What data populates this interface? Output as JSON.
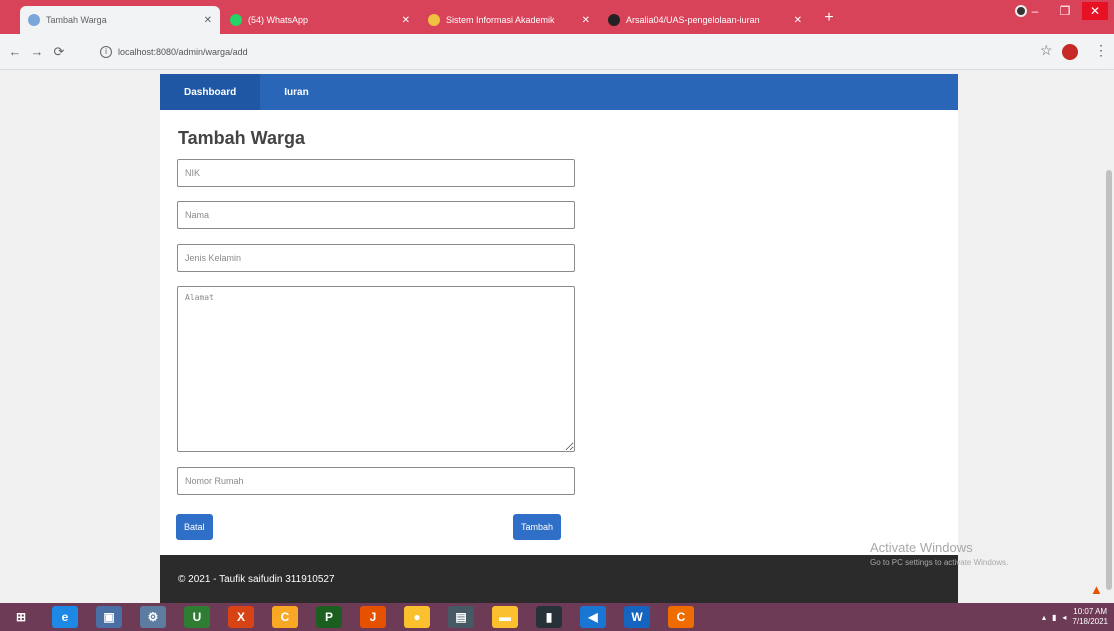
{
  "browser": {
    "tabs": [
      {
        "title": "Tambah Warga",
        "active": true,
        "icon_color": "#7aa7d9"
      },
      {
        "title": "(54) WhatsApp",
        "active": false,
        "icon_color": "#25d366"
      },
      {
        "title": "Sistem Informasi Akademik",
        "active": false,
        "icon_color": "#f0c040"
      },
      {
        "title": "Arsalia04/UAS-pengelolaan-iuran",
        "active": false,
        "icon_color": "#222222"
      }
    ],
    "new_tab": "+",
    "url": "localhost:8080/admin/warga/add",
    "info_icon": "i",
    "controls": {
      "minimize": "–",
      "maximize": "❐",
      "close": "✕"
    }
  },
  "navbar": {
    "links": [
      {
        "label": "Dashboard",
        "active": true
      },
      {
        "label": "Iuran",
        "active": false
      }
    ]
  },
  "form": {
    "title": "Tambah Warga",
    "nik_placeholder": "NIK",
    "nama_placeholder": "Nama",
    "jenis_kelamin_placeholder": "Jenis Kelamin",
    "alamat_placeholder": "Alamat",
    "nomor_rumah_placeholder": "Nomor Rumah",
    "batal_label": "Batal",
    "tambah_label": "Tambah"
  },
  "footer": {
    "text": "© 2021 - Taufik saifudin 311910527"
  },
  "watermark": {
    "title": "Activate Windows",
    "subtitle": "Go to PC settings to activate Windows."
  },
  "taskbar": {
    "clock_time": "10:07 AM",
    "clock_date": "7/18/2021",
    "items": [
      {
        "name": "start",
        "glyph": "⊞",
        "color": "#6e3b57"
      },
      {
        "name": "ie",
        "glyph": "e",
        "color": "#1e88e5"
      },
      {
        "name": "explorer",
        "glyph": "▣",
        "color": "#4a6fa5"
      },
      {
        "name": "app",
        "glyph": "⚙",
        "color": "#5c7da0"
      },
      {
        "name": "upwork",
        "glyph": "U",
        "color": "#2e7d32"
      },
      {
        "name": "xampp",
        "glyph": "X",
        "color": "#d84315"
      },
      {
        "name": "codeblocks",
        "glyph": "C",
        "color": "#f9a825"
      },
      {
        "name": "pycharm",
        "glyph": "P",
        "color": "#1b5e20"
      },
      {
        "name": "java",
        "glyph": "J",
        "color": "#e65100"
      },
      {
        "name": "chrome",
        "glyph": "●",
        "color": "#fbc02d"
      },
      {
        "name": "files",
        "glyph": "▤",
        "color": "#455a64"
      },
      {
        "name": "folder",
        "glyph": "▬",
        "color": "#fbc02d"
      },
      {
        "name": "cmd",
        "glyph": "▮",
        "color": "#263238"
      },
      {
        "name": "vscode",
        "glyph": "◀",
        "color": "#1976d2"
      },
      {
        "name": "word",
        "glyph": "W",
        "color": "#1565c0"
      },
      {
        "name": "app2",
        "glyph": "C",
        "color": "#ef6c00"
      }
    ]
  }
}
